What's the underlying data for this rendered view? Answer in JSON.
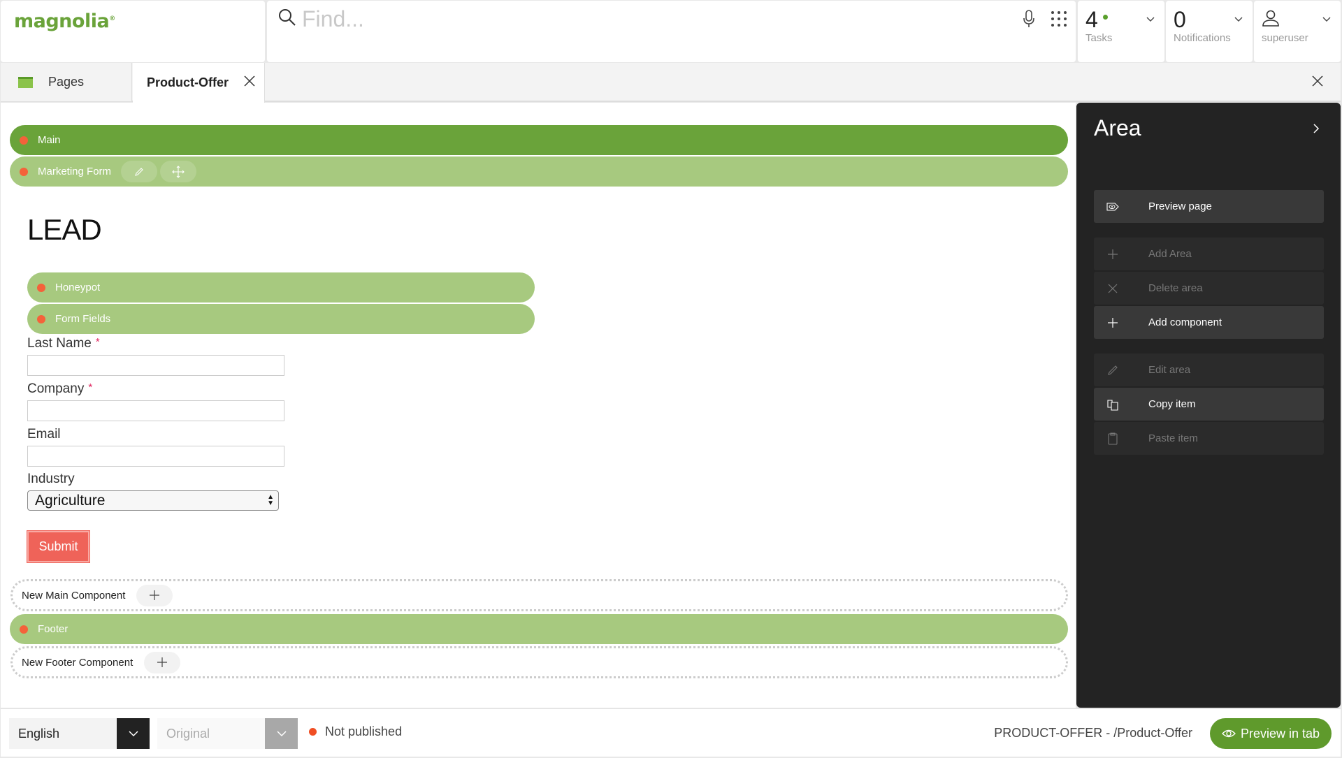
{
  "header": {
    "logo": "magnolia",
    "search": {
      "placeholder": "Find...",
      "value": ""
    },
    "tasks": {
      "count": "4",
      "label": "Tasks",
      "indicator_color": "#5aa02c"
    },
    "notifications": {
      "count": "0",
      "label": "Notifications"
    },
    "user": {
      "name": "superuser"
    }
  },
  "tabs": {
    "items": [
      {
        "label": "Pages",
        "active": false
      },
      {
        "label": "Product-Offer",
        "active": true
      }
    ]
  },
  "editor": {
    "areas": {
      "main": "Main",
      "marketing_form": "Marketing Form",
      "honeypot": "Honeypot",
      "form_fields": "Form Fields",
      "footer": "Footer"
    },
    "heading": "LEAD",
    "form": {
      "fields": [
        {
          "label": "Last Name",
          "required": true,
          "value": ""
        },
        {
          "label": "Company",
          "required": true,
          "value": ""
        },
        {
          "label": "Email",
          "required": false,
          "value": ""
        }
      ],
      "industry_label": "Industry",
      "industry_value": "Agriculture",
      "required_marker": "*",
      "submit_label": "Submit"
    },
    "new_main_component": "New Main Component",
    "new_footer_component": "New Footer Component"
  },
  "panel": {
    "title": "Area",
    "actions": [
      {
        "label": "Preview page",
        "icon": "eye-tag-icon",
        "enabled": true
      },
      {
        "label": "Add Area",
        "icon": "plus-icon",
        "enabled": false
      },
      {
        "label": "Delete area",
        "icon": "x-icon",
        "enabled": false
      },
      {
        "label": "Add component",
        "icon": "plus-icon",
        "enabled": true
      },
      {
        "label": "Edit area",
        "icon": "pencil-icon",
        "enabled": false
      },
      {
        "label": "Copy item",
        "icon": "copy-icon",
        "enabled": true
      },
      {
        "label": "Paste item",
        "icon": "clipboard-icon",
        "enabled": false
      }
    ]
  },
  "footer": {
    "language": "English",
    "version": "Original",
    "status": "Not published",
    "status_color": "#f04e23",
    "page_path": "PRODUCT-OFFER - /Product-Offer",
    "preview_button": "Preview in tab"
  },
  "colors": {
    "brand_green": "#6aa33a",
    "area_light_green": "#a7c97f",
    "submit_red": "#ef6359",
    "panel_bg": "#232323"
  }
}
